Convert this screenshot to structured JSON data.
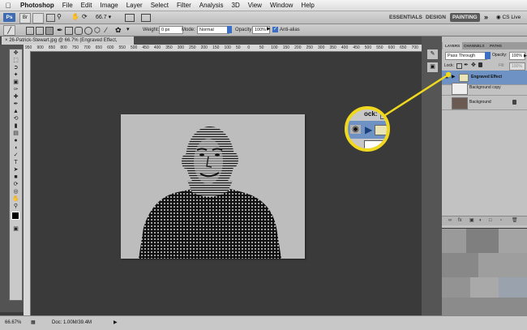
{
  "menubar": {
    "apple": "",
    "items": [
      "Photoshop",
      "File",
      "Edit",
      "Image",
      "Layer",
      "Select",
      "Filter",
      "Analysis",
      "3D",
      "View",
      "Window",
      "Help"
    ]
  },
  "appbar": {
    "zoom": "66.7",
    "workspaces": [
      "ESSENTIALS",
      "DESIGN",
      "PAINTING"
    ],
    "more": "»",
    "cslive": "CS Live"
  },
  "options": {
    "weight_label": "Weight:",
    "weight_value": "0 px",
    "mode_label": "Mode:",
    "mode_value": "Normal",
    "opacity_label": "Opacity:",
    "opacity_value": "100%",
    "antialias_label": "Anti-alias"
  },
  "document": {
    "tab_title": "26-Patrick-Stewart.jpg @ 66.7% (Engraved Effect, RGB/8#)",
    "ruler_ticks": [
      "950",
      "900",
      "850",
      "800",
      "750",
      "700",
      "650",
      "600",
      "550",
      "500",
      "450",
      "400",
      "350",
      "300",
      "250",
      "200",
      "150",
      "100",
      "50",
      "0",
      "50",
      "100",
      "150",
      "200",
      "250",
      "300",
      "350",
      "400",
      "450",
      "500",
      "550",
      "600",
      "650",
      "700"
    ]
  },
  "status": {
    "zoom": "66.67%",
    "doc": "Doc: 1.00M/39.4M"
  },
  "layers_panel": {
    "tabs": [
      "LAYERS",
      "CHANNELS",
      "PATHS"
    ],
    "blend_mode": "Pass Through",
    "opacity_label": "Opacity:",
    "opacity_value": "100%",
    "lock_label": "Lock:",
    "fill_label": "Fill:",
    "fill_value": "100%",
    "layers": [
      {
        "name": "Engraved Effect",
        "selected": true
      },
      {
        "name": "Background copy",
        "selected": false
      },
      {
        "name": "Background",
        "selected": false
      }
    ]
  },
  "callout": {
    "lock_text": "ock:"
  },
  "colors": {
    "highlight": "#f0d81f",
    "selection": "#6e92c4",
    "canvas_bg": "#3a3a3a"
  }
}
